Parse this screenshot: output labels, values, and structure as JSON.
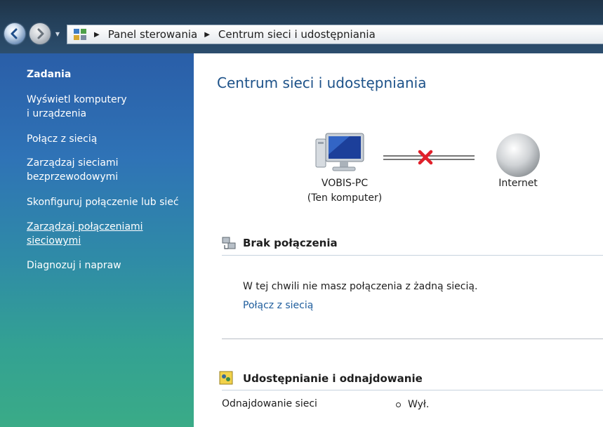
{
  "window": {
    "breadcrumb": [
      "Panel sterowania",
      "Centrum sieci i udostępniania"
    ]
  },
  "sidebar": {
    "title": "Zadania",
    "items": [
      {
        "label": "Wyświetl komputery\ni urządzenia"
      },
      {
        "label": "Połącz z siecią"
      },
      {
        "label": "Zarządzaj sieciami\nbezprzewodowymi"
      },
      {
        "label": "Skonfiguruj połączenie lub sieć"
      },
      {
        "label": "Zarządzaj połączeniami\nsieciowymi"
      },
      {
        "label": "Diagnozuj i napraw"
      }
    ]
  },
  "main": {
    "title": "Centrum sieci i udostępniania",
    "network_map": {
      "computer_label": "VOBIS-PC\n(Ten komputer)",
      "internet_label": "Internet",
      "connection_status": "disconnected"
    },
    "connection_section": {
      "heading": "Brak połączenia",
      "status_text": "W tej chwili nie masz połączenia z żadną siecią.",
      "connect_link": "Połącz z siecią"
    },
    "sharing_section": {
      "heading": "Udostępnianie i odnajdowanie",
      "rows": [
        {
          "label": "Odnajdowanie sieci",
          "value": "Wył."
        }
      ]
    }
  },
  "colors": {
    "title_blue": "#1d5289",
    "link_blue": "#1d5c9c",
    "error_red": "#e0202a"
  }
}
